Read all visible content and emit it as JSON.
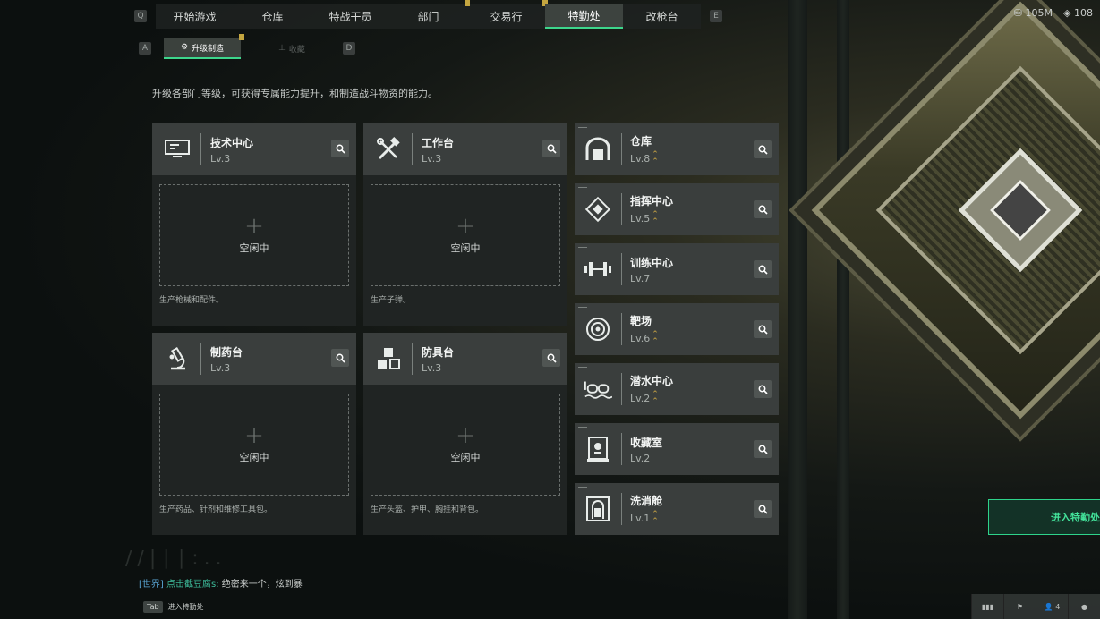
{
  "colors": {
    "accent": "#3dd68c",
    "gold": "#c4a640",
    "panel": "#3a3e3d",
    "slot_bg": "#202423"
  },
  "topnav": {
    "left_key": "Q",
    "right_key": "E",
    "tabs": [
      {
        "label": "开始游戏",
        "marker": false
      },
      {
        "label": "仓库",
        "marker": false
      },
      {
        "label": "特战干员",
        "marker": false
      },
      {
        "label": "部门",
        "marker": true
      },
      {
        "label": "交易行",
        "marker": true
      },
      {
        "label": "特勤处",
        "marker": false,
        "active": true
      },
      {
        "label": "改枪台",
        "marker": false
      }
    ],
    "currency_1": "105M",
    "currency_2": "108"
  },
  "subnav": {
    "left_key": "A",
    "right_key": "D",
    "tab_upgrade": "升级制造",
    "tab_collect": "收藏"
  },
  "description": "升级各部门等级，可获得专属能力提升，和制造战斗物资的能力。",
  "workshops": [
    {
      "name": "技术中心",
      "level": "Lv.3",
      "status": "空闲中",
      "footer": "生产枪械和配件。",
      "icon": "monitor-icon"
    },
    {
      "name": "工作台",
      "level": "Lv.3",
      "status": "空闲中",
      "footer": "生产子弹。",
      "icon": "tools-icon"
    },
    {
      "name": "制药台",
      "level": "Lv.3",
      "status": "空闲中",
      "footer": "生产药品、针剂和维修工具包。",
      "icon": "microscope-icon"
    },
    {
      "name": "防具台",
      "level": "Lv.3",
      "status": "空闲中",
      "footer": "生产头盔、护甲、胸挂和背包。",
      "icon": "cubes-icon"
    }
  ],
  "buildings": [
    {
      "name": "仓库",
      "level": "Lv.8",
      "upgradable": true,
      "icon": "warehouse-icon"
    },
    {
      "name": "指挥中心",
      "level": "Lv.5",
      "upgradable": true,
      "icon": "command-icon"
    },
    {
      "name": "训练中心",
      "level": "Lv.7",
      "upgradable": false,
      "icon": "dumbbell-icon"
    },
    {
      "name": "靶场",
      "level": "Lv.6",
      "upgradable": true,
      "icon": "target-icon"
    },
    {
      "name": "潜水中心",
      "level": "Lv.2",
      "upgradable": true,
      "icon": "goggles-icon"
    },
    {
      "name": "收藏室",
      "level": "Lv.2",
      "upgradable": false,
      "icon": "trophy-icon"
    },
    {
      "name": "洗消舱",
      "level": "Lv.1",
      "upgradable": true,
      "icon": "hazmat-icon"
    }
  ],
  "chat": {
    "channel": "[世界]",
    "user": "点击截豆腐s:",
    "message": " 绝密来一个，炫到暴"
  },
  "tab_hint": {
    "key": "Tab",
    "label": "进入特勤处"
  },
  "enter_button": "进入特勤处",
  "bottom_right": {
    "players_count": "4"
  }
}
